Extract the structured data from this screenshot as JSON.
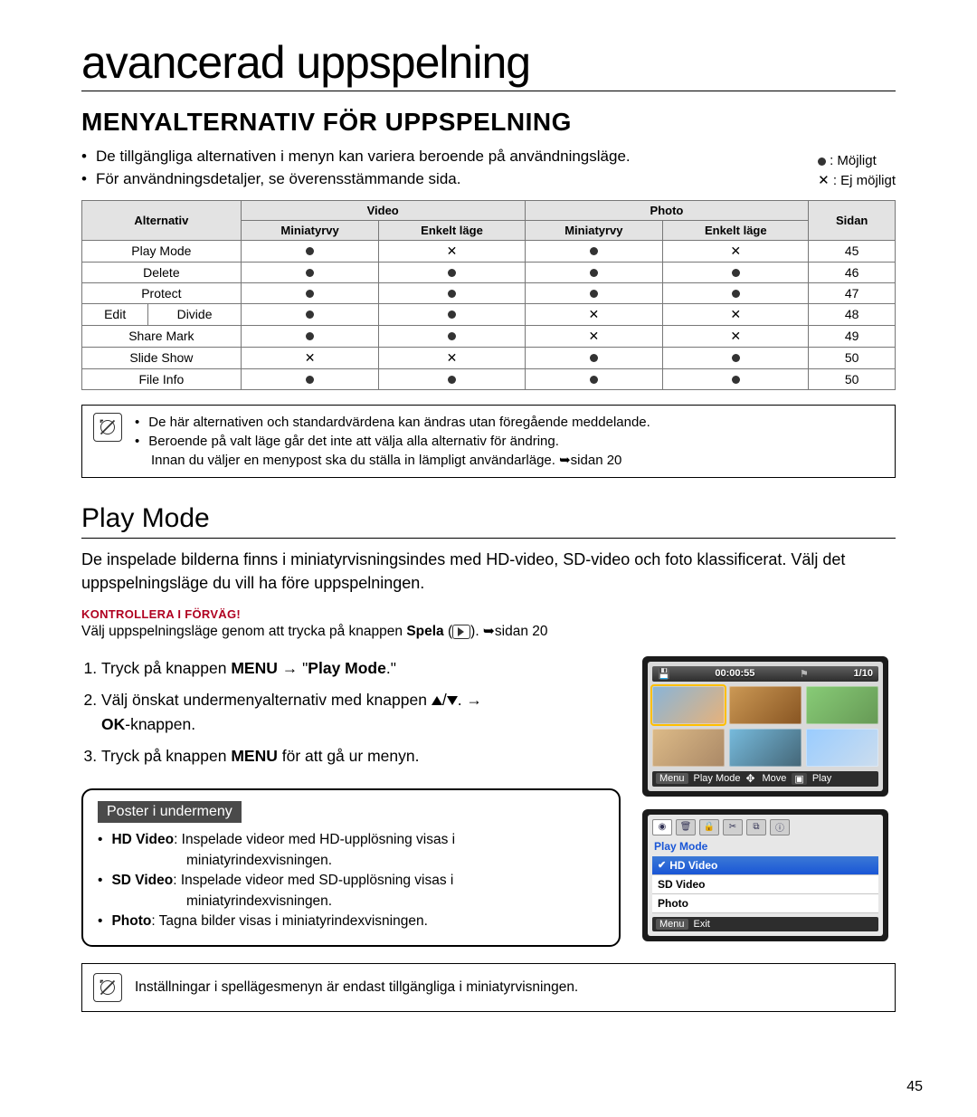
{
  "pageNumber": "45",
  "title": "avancerad uppspelning",
  "section1": {
    "heading": "MENYALTERNATIV FÖR UPPSPELNING",
    "bullets": [
      "De tillgängliga alternativen i menyn kan variera beroende på användningsläge.",
      "För användningsdetaljer, se överensstämmande sida."
    ],
    "legend": {
      "possible": ": Möjligt",
      "notPossible": ": Ej möjligt"
    }
  },
  "table": {
    "headers": {
      "alternativ": "Alternativ",
      "video": "Video",
      "photo": "Photo",
      "miniatyrvy": "Miniatyrvy",
      "enkelt": "Enkelt läge",
      "sidan": "Sidan"
    },
    "rows": [
      {
        "name": "Play Mode",
        "sub": "",
        "v_m": "●",
        "v_e": "✕",
        "p_m": "●",
        "p_e": "✕",
        "page": "45"
      },
      {
        "name": "Delete",
        "sub": "",
        "v_m": "●",
        "v_e": "●",
        "p_m": "●",
        "p_e": "●",
        "page": "46"
      },
      {
        "name": "Protect",
        "sub": "",
        "v_m": "●",
        "v_e": "●",
        "p_m": "●",
        "p_e": "●",
        "page": "47"
      },
      {
        "name": "Edit",
        "sub": "Divide",
        "v_m": "●",
        "v_e": "●",
        "p_m": "✕",
        "p_e": "✕",
        "page": "48"
      },
      {
        "name": "Share Mark",
        "sub": "",
        "v_m": "●",
        "v_e": "●",
        "p_m": "✕",
        "p_e": "✕",
        "page": "49"
      },
      {
        "name": "Slide Show",
        "sub": "",
        "v_m": "✕",
        "v_e": "✕",
        "p_m": "●",
        "p_e": "●",
        "page": "50"
      },
      {
        "name": "File Info",
        "sub": "",
        "v_m": "●",
        "v_e": "●",
        "p_m": "●",
        "p_e": "●",
        "page": "50"
      }
    ]
  },
  "notebox1": {
    "lines": [
      "De här alternativen och standardvärdena kan ändras utan föregående meddelande.",
      "Beroende på valt läge går det inte att välja alla alternativ för ändring."
    ],
    "tail": "Innan du väljer en menypost ska du ställa in lämpligt användarläge. ➥sidan 20"
  },
  "section2": {
    "heading": "Play Mode",
    "body": "De inspelade bilderna finns i miniatyrvisningsindes med HD-video, SD-video och foto klassificerat. Välj det uppspelningsläge du vill ha före uppspelningen.",
    "redCaption": "KONTROLLERA I FÖRVÄG!",
    "redBody_a": "Välj uppspelningsläge genom att trycka på knappen ",
    "redBody_b": "Spela",
    "redBody_c": " (",
    "redBody_d": "). ➥sidan 20",
    "steps": {
      "s1_a": "Tryck på knappen ",
      "s1_b": "MENU",
      "s1_c": " → \"",
      "s1_d": "Play Mode",
      "s1_e": ".\"",
      "s2_a": "Välj önskat undermenyalternativ med knappen ",
      "s2_b": ". → ",
      "s2_c": "OK",
      "s2_d": "-knappen.",
      "s3_a": "Tryck på knappen ",
      "s3_b": "MENU",
      "s3_c": " för att gå ur menyn."
    }
  },
  "subbox": {
    "title": "Poster i undermeny",
    "items": [
      {
        "k": "HD Video",
        "txt": ": Inspelade videor med HD-upplösning visas i",
        "cont": "miniatyrindexvisningen."
      },
      {
        "k": "SD Video",
        "txt": ": Inspelade videor med SD-upplösning visas i",
        "cont": "miniatyrindexvisningen."
      },
      {
        "k": "Photo",
        "txt": ": Tagna bilder visas i miniatyrindexvisningen.",
        "cont": ""
      }
    ]
  },
  "screens": {
    "time": "00:00:55",
    "counter": "1/10",
    "bottom": {
      "menu": "Menu",
      "playmode": "Play Mode",
      "move": "Move",
      "play": "Play"
    },
    "menu": {
      "title": "Play Mode",
      "items": [
        "HD Video",
        "SD Video",
        "Photo"
      ],
      "exit": "Exit",
      "menu": "Menu"
    }
  },
  "footerNote": "Inställningar i spellägesmenyn är endast tillgängliga i miniatyrvisningen."
}
